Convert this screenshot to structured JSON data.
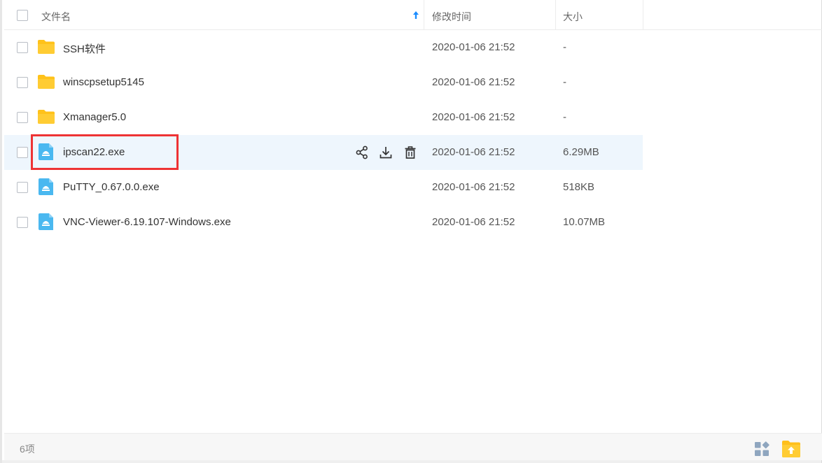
{
  "header": {
    "name_label": "文件名",
    "modified_label": "修改时间",
    "size_label": "大小",
    "sort_icon": "arrow-up-icon"
  },
  "files": [
    {
      "name": "SSH软件",
      "modified": "2020-01-06 21:52",
      "size": "-",
      "type": "folder",
      "icon": "folder-icon"
    },
    {
      "name": "winscpsetup5145",
      "modified": "2020-01-06 21:52",
      "size": "-",
      "type": "folder",
      "icon": "folder-icon"
    },
    {
      "name": "Xmanager5.0",
      "modified": "2020-01-06 21:52",
      "size": "-",
      "type": "folder",
      "icon": "folder-icon"
    },
    {
      "name": "ipscan22.exe",
      "modified": "2020-01-06 21:52",
      "size": "6.29MB",
      "type": "exe",
      "icon": "exe-file-icon",
      "hovered": true
    },
    {
      "name": "PuTTY_0.67.0.0.exe",
      "modified": "2020-01-06 21:52",
      "size": "518KB",
      "type": "exe",
      "icon": "exe-file-icon"
    },
    {
      "name": "VNC-Viewer-6.19.107-Windows.exe",
      "modified": "2020-01-06 21:52",
      "size": "10.07MB",
      "type": "exe",
      "icon": "exe-file-icon"
    }
  ],
  "row_actions": [
    "share-icon",
    "download-icon",
    "delete-icon"
  ],
  "footer": {
    "count_label": "6项",
    "grid_view_icon": "grid-view-icon",
    "upload_icon": "upload-icon"
  },
  "colors": {
    "folder": "#ffc21a",
    "exe": "#4ab8f0",
    "hover_row": "#eef6fd",
    "highlight": "#ee3334",
    "sort_arrow": "#1a8cff"
  }
}
